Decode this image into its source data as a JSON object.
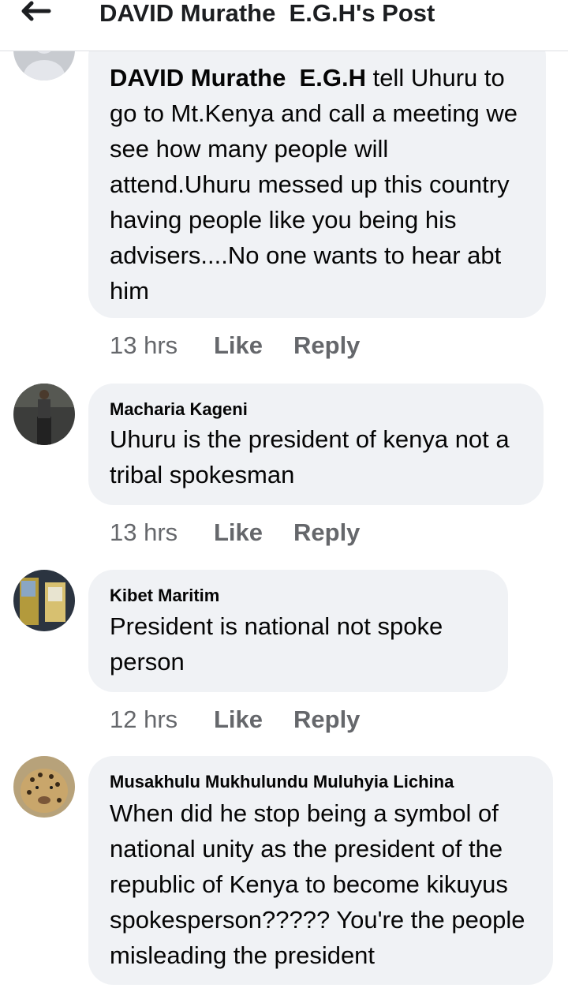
{
  "header": {
    "title": "DAVID Murathe  E.G.H's Post",
    "back_icon": "back-arrow-icon"
  },
  "comments": [
    {
      "author": "DAVID Murathe  E.G.H",
      "text": " tell Uhuru to go to Mt.Kenya and call a meeting we see how many people will attend.Uhuru messed up this country having people like you being his advisers....No one wants to hear abt him",
      "time": "13 hrs",
      "like": "Like",
      "reply": "Reply"
    },
    {
      "author": "Macharia Kageni",
      "text": "Uhuru is the president of kenya not a tribal spokesman",
      "time": "13 hrs",
      "like": "Like",
      "reply": "Reply"
    },
    {
      "author": "Kibet Maritim",
      "text": " President is national  not spoke person",
      "time": "12 hrs",
      "like": "Like",
      "reply": "Reply"
    },
    {
      "author": "Musakhulu Mukhulundu Muluhyia Lichina",
      "text": "When did he stop being a symbol of national unity as the president of the republic of Kenya to become kikuyus spokesperson????? You're the people misleading the president"
    }
  ],
  "colors": {
    "bubble": "#f0f2f5",
    "meta_text": "#65676b",
    "text": "#050505"
  }
}
